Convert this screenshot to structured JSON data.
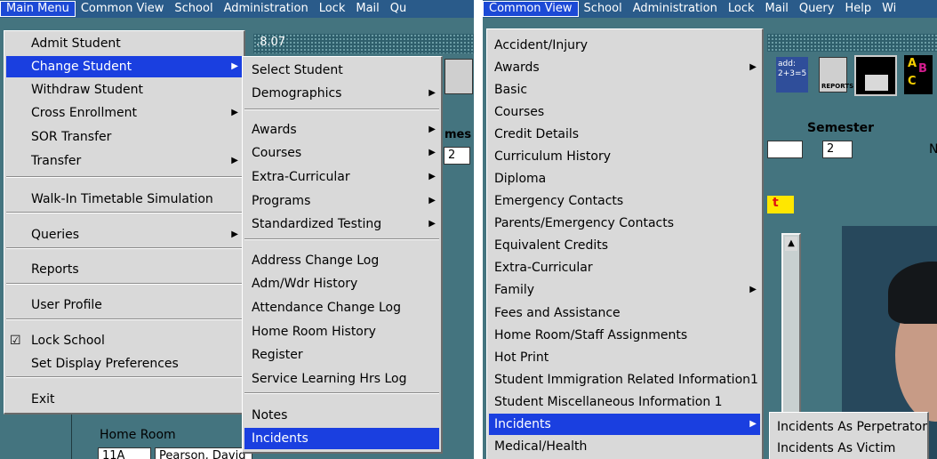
{
  "left": {
    "menubar": [
      "Main Menu",
      "Common View",
      "School",
      "Administration",
      "Lock",
      "Mail",
      "Qu"
    ],
    "bg_text": {
      "version": ".8.07",
      "semester_partial": "mes",
      "semester_value": "2",
      "home_room_label": "Home Room",
      "home_room_value": "11A",
      "teacher_partial": "Pearson, David"
    },
    "main_menu": [
      {
        "label": "Admit Student"
      },
      {
        "label": "Change Student",
        "submenu": true,
        "highlighted": true
      },
      {
        "label": "Withdraw Student"
      },
      {
        "label": "Cross Enrollment",
        "submenu": true
      },
      {
        "label": "SOR Transfer"
      },
      {
        "label": "Transfer",
        "submenu": true
      },
      {
        "label": "Walk-In Timetable Simulation"
      },
      {
        "label": "Queries",
        "submenu": true
      },
      {
        "label": "Reports"
      },
      {
        "label": "User Profile"
      },
      {
        "label": "Lock School",
        "checked": true
      },
      {
        "label": "Set Display Preferences"
      },
      {
        "label": "Exit"
      }
    ],
    "sub_menu": [
      {
        "label": "Select Student"
      },
      {
        "label": "Demographics",
        "submenu": true
      },
      {
        "label": "Awards",
        "submenu": true
      },
      {
        "label": "Courses",
        "submenu": true
      },
      {
        "label": "Extra-Curricular",
        "submenu": true
      },
      {
        "label": "Programs",
        "submenu": true
      },
      {
        "label": "Standardized Testing",
        "submenu": true
      },
      {
        "label": "Address Change Log"
      },
      {
        "label": "Adm/Wdr History"
      },
      {
        "label": "Attendance Change Log"
      },
      {
        "label": "Home Room  History"
      },
      {
        "label": "Register"
      },
      {
        "label": "Service Learning Hrs Log"
      },
      {
        "label": "Notes"
      },
      {
        "label": "Incidents",
        "highlighted": true
      }
    ]
  },
  "right": {
    "menubar": [
      "Common View",
      "School",
      "Administration",
      "Lock",
      "Mail",
      "Query",
      "Help",
      "Wi"
    ],
    "bg_text": {
      "semester_label": "Semester",
      "semester_value": "2",
      "n_partial": "N",
      "alert_partial": "t",
      "add_icon": "add:\n2+3=5",
      "reports_icon": "REPORTS"
    },
    "menu": [
      {
        "label": "Accident/Injury"
      },
      {
        "label": "Awards",
        "submenu": true
      },
      {
        "label": "Basic"
      },
      {
        "label": "Courses"
      },
      {
        "label": "Credit Details"
      },
      {
        "label": "Curriculum History"
      },
      {
        "label": "Diploma"
      },
      {
        "label": "Emergency Contacts"
      },
      {
        "label": "Parents/Emergency Contacts"
      },
      {
        "label": "Equivalent Credits"
      },
      {
        "label": "Extra-Curricular"
      },
      {
        "label": "Family",
        "submenu": true
      },
      {
        "label": "Fees and Assistance"
      },
      {
        "label": "Home Room/Staff Assignments"
      },
      {
        "label": "Hot Print"
      },
      {
        "label": "Student Immigration Related Information1"
      },
      {
        "label": "Student Miscellaneous Information 1"
      },
      {
        "label": "Incidents",
        "submenu": true,
        "highlighted": true
      },
      {
        "label": "Medical/Health"
      }
    ],
    "incidents_menu": [
      {
        "label": "Incidents As Perpetrator"
      },
      {
        "label": "Incidents As Victim"
      }
    ]
  },
  "colors": {
    "menu_bg": "#d9d9d9",
    "highlight": "#1a3fe0",
    "menubar": "#2a5b8a",
    "app_bg": "#44747f"
  }
}
